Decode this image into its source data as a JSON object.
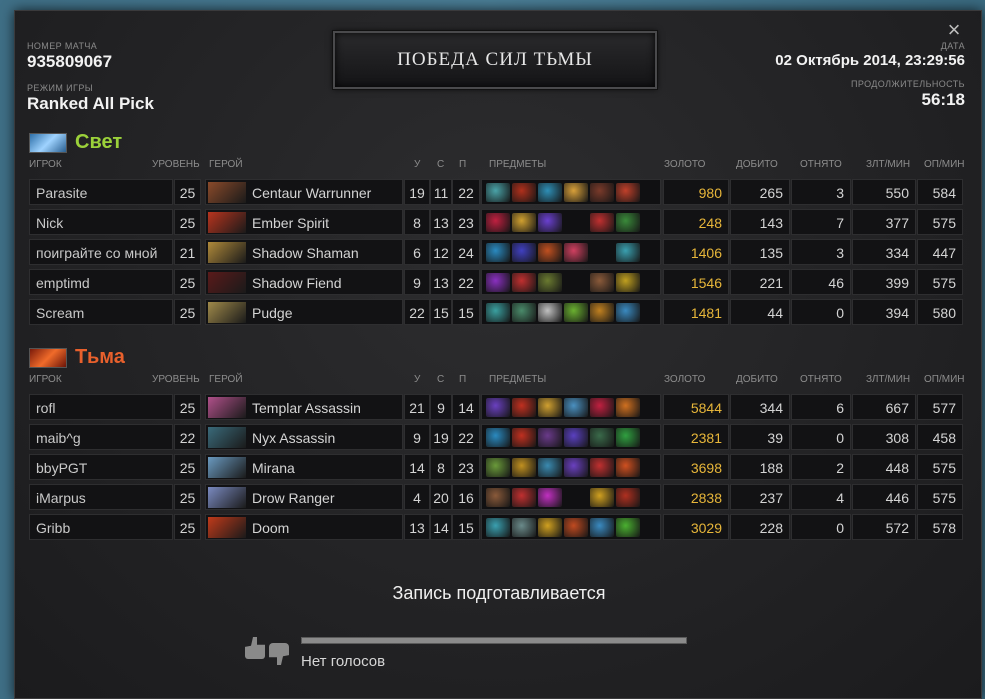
{
  "match": {
    "id_label": "НОМЕР МАТЧА",
    "id": "935809067",
    "mode_label": "РЕЖИМ ИГРЫ",
    "mode": "Ranked All Pick",
    "date_label": "ДАТА",
    "date": "02 Октябрь 2014, 23:29:56",
    "duration_label": "ПРОДОЛЖИТЕЛЬНОСТЬ",
    "duration": "56:18",
    "winner": "ПОБЕДА СИЛ ТЬМЫ",
    "close_icon": "×"
  },
  "columns": {
    "player": "ИГРОК",
    "level": "УРОВЕНЬ",
    "hero": "ГЕРОЙ",
    "kills": "У",
    "deaths": "С",
    "assists": "П",
    "items": "ПРЕДМЕТЫ",
    "gold": "ЗОЛОТО",
    "last_hits": "ДОБИТО",
    "denies": "ОТНЯТО",
    "gpm": "ЗЛТ/МИН",
    "xpm": "ОП/МИН"
  },
  "radiant": {
    "name": "Свет",
    "players": [
      {
        "player": "Parasite",
        "level": "25",
        "hero": "Centaur Warrunner",
        "portrait": "#8a4a2a",
        "k": "19",
        "d": "11",
        "a": "22",
        "items": [
          "#4aa3a8",
          "#b0301c",
          "#2e8fb6",
          "#d8a03a",
          "#7a3a2a",
          "#c0402a"
        ],
        "gold": "980",
        "lh": "265",
        "dn": "3",
        "gpm": "550",
        "xpm": "584"
      },
      {
        "player": "Nick",
        "level": "25",
        "hero": "Ember Spirit",
        "portrait": "#b8341e",
        "k": "8",
        "d": "13",
        "a": "23",
        "items": [
          "#c02040",
          "#d0a030",
          "#6a40d0",
          "",
          "#c03030",
          "#3a8a3a"
        ],
        "gold": "248",
        "lh": "143",
        "dn": "7",
        "gpm": "377",
        "xpm": "575"
      },
      {
        "player": "поиграйте со мной",
        "level": "21",
        "hero": "Shadow Shaman",
        "portrait": "#b08a3a",
        "k": "6",
        "d": "12",
        "a": "24",
        "items": [
          "#2a8ac0",
          "#4040c0",
          "#c05020",
          "#d04060",
          "",
          "#3aa0b0"
        ],
        "gold": "1406",
        "lh": "135",
        "dn": "3",
        "gpm": "334",
        "xpm": "447"
      },
      {
        "player": "emptimd",
        "level": "25",
        "hero": "Shadow Fiend",
        "portrait": "#5a1a1a",
        "k": "9",
        "d": "13",
        "a": "22",
        "items": [
          "#8a30c0",
          "#c03030",
          "#6a7a30",
          "",
          "#8a5a3a",
          "#c0a020"
        ],
        "gold": "1546",
        "lh": "221",
        "dn": "46",
        "gpm": "399",
        "xpm": "575"
      },
      {
        "player": "Scream",
        "level": "25",
        "hero": "Pudge",
        "portrait": "#a08a4a",
        "k": "22",
        "d": "15",
        "a": "15",
        "items": [
          "#3aa0a0",
          "#4a8a6a",
          "#c0c0c0",
          "#6ab030",
          "#c08020",
          "#3a8ac0"
        ],
        "gold": "1481",
        "lh": "44",
        "dn": "0",
        "gpm": "394",
        "xpm": "580"
      }
    ]
  },
  "dire": {
    "name": "Тьма",
    "players": [
      {
        "player": "rofl",
        "level": "25",
        "hero": "Templar Assassin",
        "portrait": "#b0508a",
        "k": "21",
        "d": "9",
        "a": "14",
        "items": [
          "#6a40c0",
          "#c03020",
          "#d0a030",
          "#4a90c0",
          "#c02040",
          "#d07020"
        ],
        "gold": "5844",
        "lh": "344",
        "dn": "6",
        "gpm": "667",
        "xpm": "577"
      },
      {
        "player": "maib^g",
        "level": "22",
        "hero": "Nyx Assassin",
        "portrait": "#3a6a7a",
        "k": "9",
        "d": "19",
        "a": "22",
        "items": [
          "#2a8ac0",
          "#c03020",
          "#6a3a8a",
          "#5a40c0",
          "#3a6a4a",
          "#30a040"
        ],
        "gold": "2381",
        "lh": "39",
        "dn": "0",
        "gpm": "308",
        "xpm": "458"
      },
      {
        "player": "bbyPGT",
        "level": "25",
        "hero": "Mirana",
        "portrait": "#6a9ac0",
        "k": "14",
        "d": "8",
        "a": "23",
        "items": [
          "#6a9a3a",
          "#c09020",
          "#3a8ab0",
          "#6a40c0",
          "#c03030",
          "#d05020"
        ],
        "gold": "3698",
        "lh": "188",
        "dn": "2",
        "gpm": "448",
        "xpm": "575"
      },
      {
        "player": "iMarpus",
        "level": "25",
        "hero": "Drow Ranger",
        "portrait": "#7a8ac0",
        "k": "4",
        "d": "20",
        "a": "16",
        "items": [
          "#8a5a3a",
          "#c03030",
          "#c030c0",
          "",
          "#d0a020",
          "#b03020"
        ],
        "gold": "2838",
        "lh": "237",
        "dn": "4",
        "gpm": "446",
        "xpm": "575"
      },
      {
        "player": "Gribb",
        "level": "25",
        "hero": "Doom",
        "portrait": "#c03a1a",
        "k": "13",
        "d": "14",
        "a": "15",
        "items": [
          "#3aa0b0",
          "#6a8a8a",
          "#d0a020",
          "#c04a20",
          "#3a8ac0",
          "#4ab030"
        ],
        "gold": "3029",
        "lh": "228",
        "dn": "0",
        "gpm": "572",
        "xpm": "578"
      }
    ]
  },
  "replay": {
    "status": "Запись подготавливается"
  },
  "votes": {
    "text": "Нет голосов"
  }
}
